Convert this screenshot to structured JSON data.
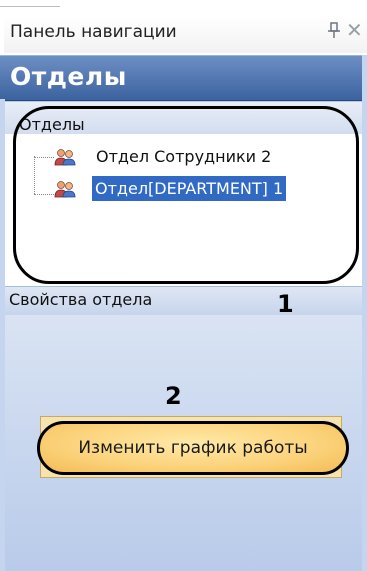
{
  "header": {
    "title": "Панель навигации"
  },
  "banner": {
    "title": "Отделы"
  },
  "departments_section": {
    "label": "Отделы",
    "items": [
      {
        "label": "Отдел Сотрудники 2",
        "selected": false,
        "icon": "people-icon"
      },
      {
        "label": "Отдел[DEPARTMENT] 1",
        "selected": true,
        "icon": "people-icon"
      }
    ]
  },
  "properties_section": {
    "label": "Свойства отдела"
  },
  "actions": {
    "change_schedule_label": "Изменить график работы"
  },
  "callouts": {
    "one": "1",
    "two": "2"
  },
  "colors": {
    "banner": "#4a72ad",
    "selection": "#316ac5",
    "button": "#fbd27a"
  }
}
